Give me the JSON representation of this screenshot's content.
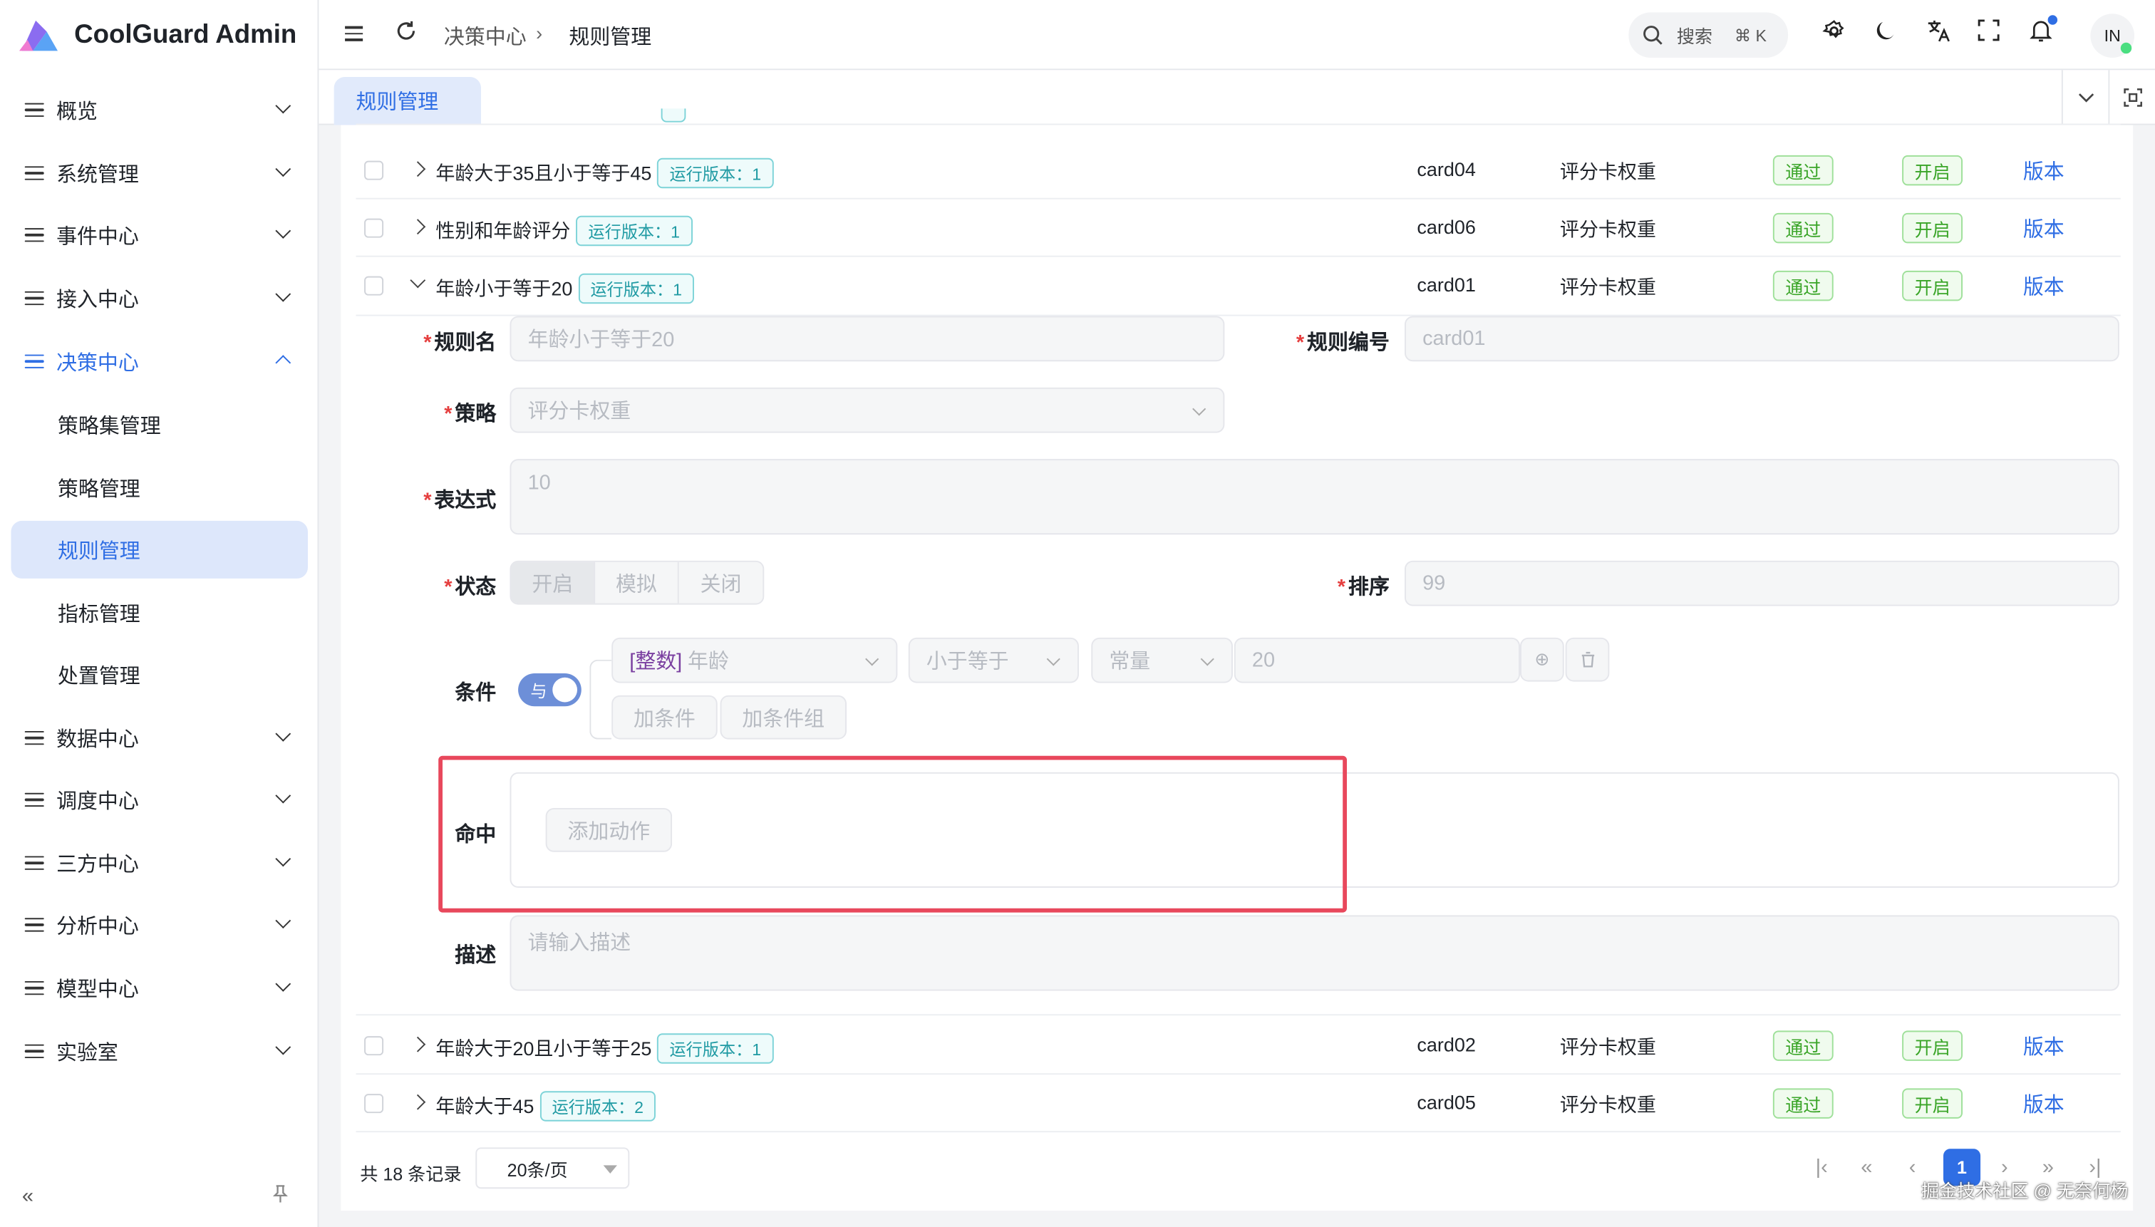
{
  "app": {
    "title": "CoolGuard Admin"
  },
  "sidebar": {
    "menu": [
      {
        "label": "概览"
      },
      {
        "label": "系统管理"
      },
      {
        "label": "事件中心"
      },
      {
        "label": "接入中心"
      },
      {
        "label": "决策中心"
      },
      {
        "label": "数据中心"
      },
      {
        "label": "调度中心"
      },
      {
        "label": "三方中心"
      },
      {
        "label": "分析中心"
      },
      {
        "label": "模型中心"
      },
      {
        "label": "实验室"
      }
    ],
    "submenu": [
      {
        "label": "策略集管理"
      },
      {
        "label": "策略管理"
      },
      {
        "label": "规则管理"
      },
      {
        "label": "指标管理"
      },
      {
        "label": "处置管理"
      }
    ]
  },
  "header": {
    "breadcrumb": [
      "决策中心",
      "规则管理"
    ],
    "search": {
      "label": "搜索",
      "shortcut": "⌘ K"
    },
    "avatar": "IN"
  },
  "tabs": [
    {
      "label": "规则管理"
    }
  ],
  "table": {
    "rows_top": [
      {
        "name": "年龄大于35且小于等于45",
        "version": "运行版本：1",
        "code": "card04",
        "strategy": "评分卡权重",
        "result": "通过",
        "status": "开启",
        "action": "版本"
      },
      {
        "name": "性别和年龄评分",
        "version": "运行版本：1",
        "code": "card06",
        "strategy": "评分卡权重",
        "result": "通过",
        "status": "开启",
        "action": "版本"
      },
      {
        "name": "年龄小于等于20",
        "version": "运行版本：1",
        "code": "card01",
        "strategy": "评分卡权重",
        "result": "通过",
        "status": "开启",
        "action": "版本"
      }
    ],
    "rows_bottom": [
      {
        "name": "年龄大于20且小于等于25",
        "version": "运行版本：1",
        "code": "card02",
        "strategy": "评分卡权重",
        "result": "通过",
        "status": "开启",
        "action": "版本"
      },
      {
        "name": "年龄大于45",
        "version": "运行版本：2",
        "code": "card05",
        "strategy": "评分卡权重",
        "result": "通过",
        "status": "开启",
        "action": "版本"
      }
    ]
  },
  "form": {
    "rule_name": {
      "label": "规则名",
      "value": "年龄小于等于20"
    },
    "rule_code": {
      "label": "规则编号",
      "value": "card01"
    },
    "strategy": {
      "label": "策略",
      "value": "评分卡权重"
    },
    "expression": {
      "label": "表达式",
      "value": "10"
    },
    "status": {
      "label": "状态",
      "options": [
        "开启",
        "模拟",
        "关闭"
      ],
      "selected": "开启"
    },
    "sort": {
      "label": "排序",
      "value": "99"
    },
    "condition": {
      "label": "条件",
      "logic": "与",
      "field_type": "[整数]",
      "field": "年龄",
      "operator": "小于等于",
      "value_type": "常量",
      "value": "20",
      "add_condition": "加条件",
      "add_group": "加条件组"
    },
    "hit": {
      "label": "命中",
      "add_action": "添加动作"
    },
    "description": {
      "label": "描述",
      "placeholder": "请输入描述"
    }
  },
  "pagination": {
    "total": "共 18 条记录",
    "page_size": "20条/页",
    "current": "1"
  },
  "watermark": "掘金技术社区 @ 无奈何杨",
  "colors": {
    "primary": "#2f6ee4",
    "highlight_box": "#e8485c",
    "tag_green": "#3aa528",
    "tag_cyan": "#1f9aa3"
  }
}
